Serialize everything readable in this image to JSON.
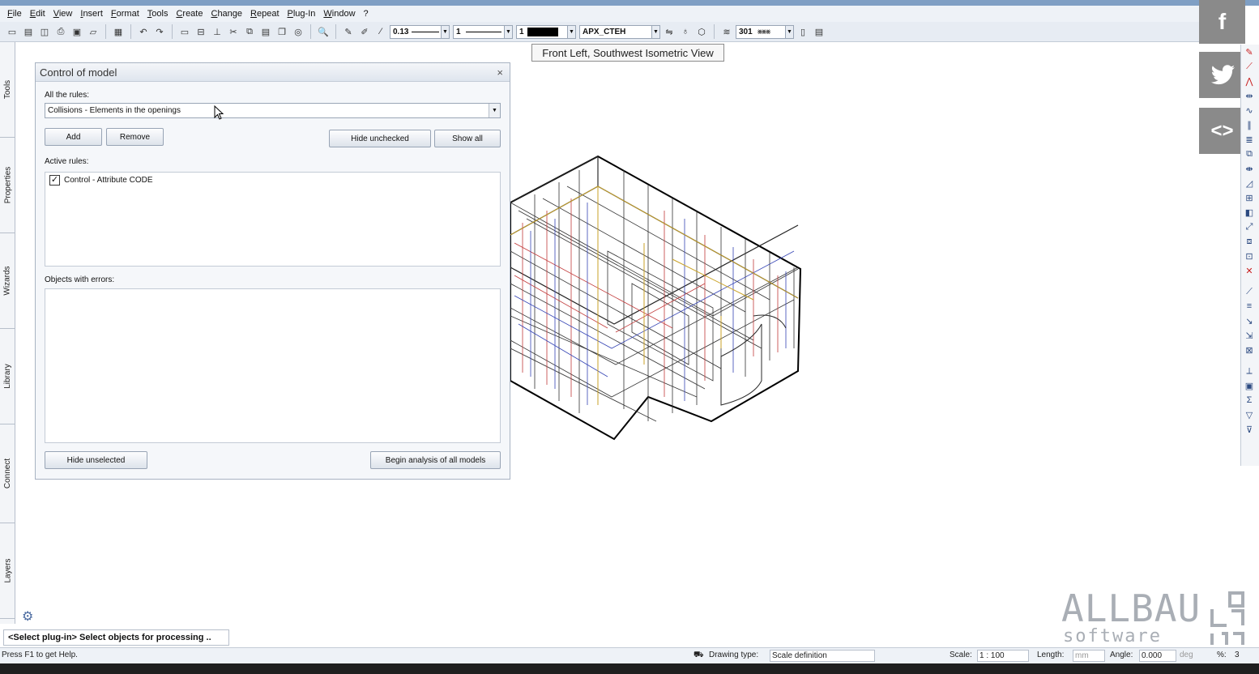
{
  "menu": [
    "File",
    "Edit",
    "View",
    "Insert",
    "Format",
    "Tools",
    "Create",
    "Change",
    "Repeat",
    "Plug-In",
    "Window",
    "?"
  ],
  "toolbar": {
    "pen_value": "0.13",
    "line_value": "1",
    "color_value": "1",
    "layer_value": "APX_CTEH",
    "pattern_value": "301"
  },
  "tooltip": "Front Left, Southwest Isometric View",
  "left_tabs": [
    "Tools",
    "Properties",
    "Wizards",
    "Library",
    "Connect",
    "Layers"
  ],
  "social": {
    "facebook": "f",
    "code": "<>"
  },
  "panel": {
    "title": "Control of model",
    "all_rules_label": "All the rules:",
    "selected_rule": "Collisions - Elements in the openings",
    "add_label": "Add",
    "remove_label": "Remove",
    "hide_unchecked_label": "Hide unchecked",
    "show_all_label": "Show all",
    "active_rules_label": "Active rules:",
    "active_rules": [
      {
        "label": "Control - Attribute CODE",
        "checked": true
      }
    ],
    "objects_errors_label": "Objects with errors:",
    "hide_unselected_label": "Hide unselected",
    "begin_analysis_label": "Begin analysis of all models"
  },
  "watermark": {
    "brand": "ALLBAU",
    "sub": "software"
  },
  "command_line": "<Select plug-in> Select objects for processing ..",
  "status": {
    "help": "Press F1 to get Help.",
    "drawing_type_label": "Drawing type:",
    "drawing_type_value": "Scale definition",
    "scale_label": "Scale:",
    "scale_value": "1 : 100",
    "length_label": "Length:",
    "length_unit": "mm",
    "angle_label": "Angle:",
    "angle_value": "0.000",
    "angle_unit": "deg",
    "percent_label": "%:",
    "percent_value": "3"
  }
}
